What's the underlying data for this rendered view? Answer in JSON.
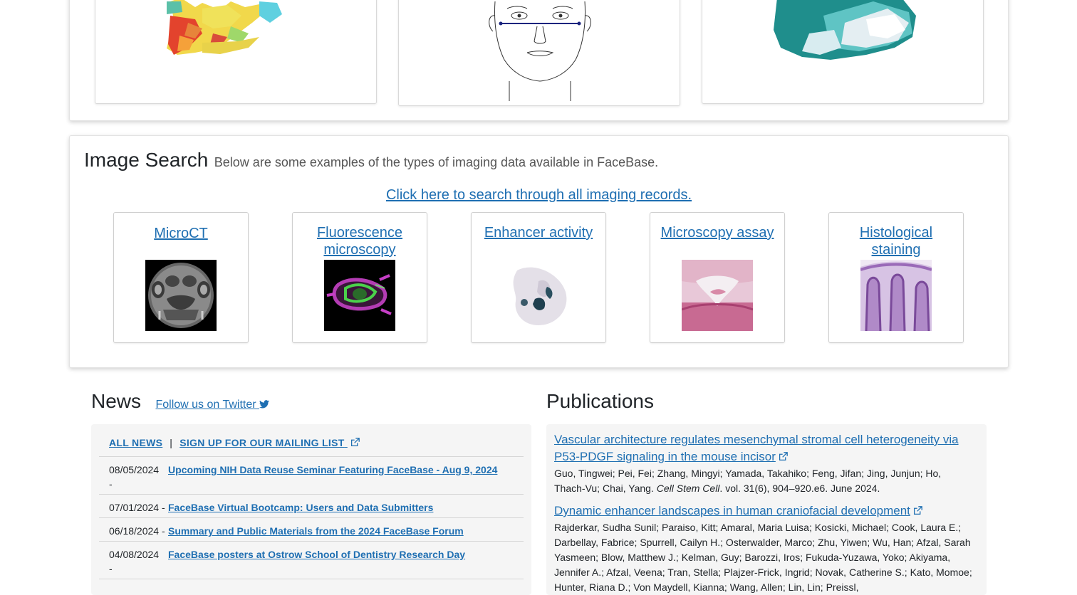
{
  "image_search": {
    "title": "Image Search",
    "description": "Below are some examples of the types of imaging data available in FaceBase.",
    "search_all_link": "Click here to search through all imaging records.",
    "tiles": [
      {
        "label": "MicroCT",
        "icon": "microct-image"
      },
      {
        "label": "Fluorescence microscopy",
        "icon": "fluorescence-image"
      },
      {
        "label": "Enhancer activity",
        "icon": "embryo-image"
      },
      {
        "label": "Microscopy assay",
        "icon": "microscopy-image"
      },
      {
        "label": "Histological staining",
        "icon": "histology-image"
      }
    ]
  },
  "news": {
    "title": "News",
    "twitter_link": "Follow us on Twitter",
    "all_news": "ALL NEWS",
    "separator": "|",
    "mailing_list": "SIGN UP FOR OUR MAILING LIST",
    "items": [
      {
        "date": "08/05/2024",
        "dash": "-",
        "title": "Upcoming NIH Data Reuse Seminar Featuring FaceBase - Aug 9, 2024"
      },
      {
        "date": "07/01/2024 -",
        "title": "FaceBase Virtual Bootcamp: Users and Data Submitters"
      },
      {
        "date": "06/18/2024 -",
        "title": "Summary and Public Materials from the 2024 FaceBase Forum"
      },
      {
        "date": "04/08/2024",
        "dash": "-",
        "title": "FaceBase posters at Ostrow School of Dentistry Research Day"
      }
    ]
  },
  "publications": {
    "title": "Publications",
    "items": [
      {
        "title": "Vascular architecture regulates mesenchymal stromal cell heterogeneity via P53-PDGF signaling in the mouse incisor",
        "authors": "Guo, Tingwei; Pei, Fei; Zhang, Mingyi; Yamada, Takahiko; Feng, Jifan; Jing, Junjun; Ho, Thach-Vu; Chai, Yang.",
        "journal": "Cell Stem Cell",
        "details": ". vol. 31(6), 904–920.e6. June 2024."
      },
      {
        "title": "Dynamic enhancer landscapes in human craniofacial development",
        "authors": "Rajderkar, Sudha Sunil; Paraiso, Kitt; Amaral, Maria Luisa; Kosicki, Michael; Cook, Laura E.; Darbellay, Fabrice; Spurrell, Cailyn H.; Osterwalder, Marco; Zhu, Yiwen; Wu, Han; Afzal, Sarah Yasmeen; Blow, Matthew J.; Kelman, Guy; Barozzi, Iros; Fukuda-Yuzawa, Yoko; Akiyama, Jennifer A.; Afzal, Veena; Tran, Stella; Plajzer-Frick, Ingrid; Novak, Catherine S.; Kato, Momoe; Hunter, Riana D.; Von Maydell, Kianna; Wang, Allen; Lin, Lin; Preissl,"
      }
    ]
  },
  "top_images": [
    "skull-model-image",
    "face-diagram-image",
    "3d-scan-image"
  ],
  "colors": {
    "link": "#1f6fb2",
    "panel_bg": "#f5f5f5"
  }
}
